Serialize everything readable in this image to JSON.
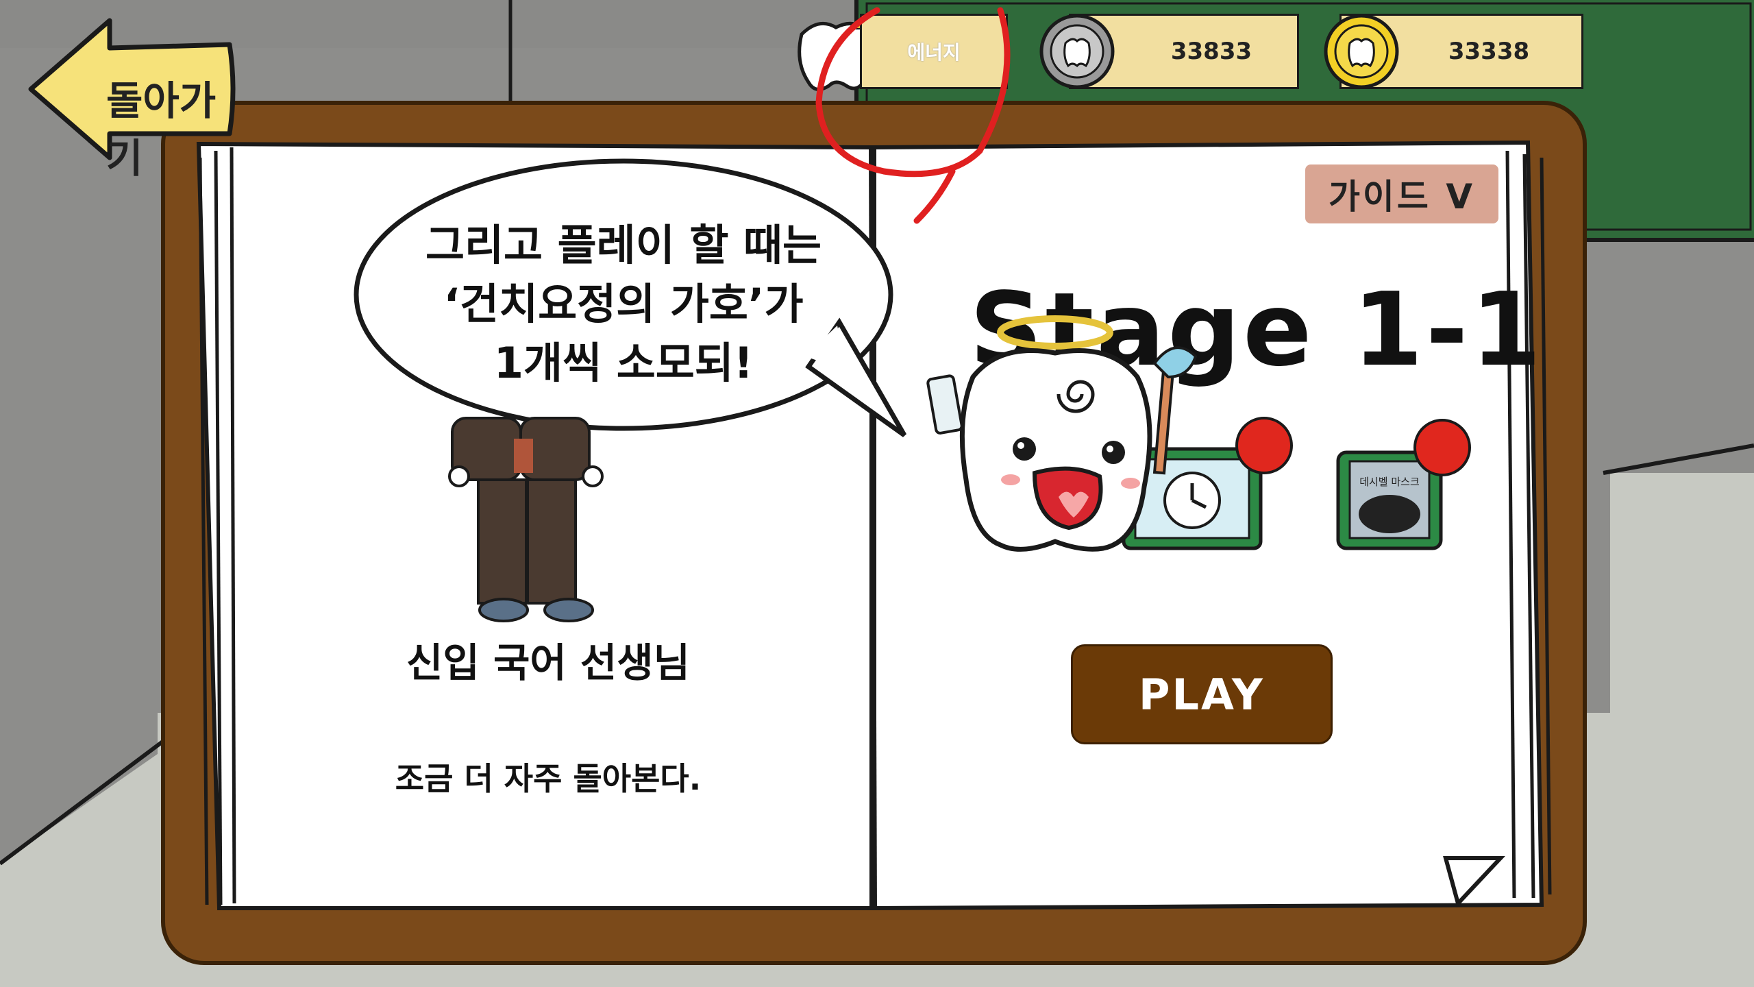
{
  "hud": {
    "energy_label": "에너지",
    "silver_coins": "33833",
    "gold_coins": "33338"
  },
  "back_button": {
    "label": "돌아가기"
  },
  "guide_button": {
    "label": "가이드 V"
  },
  "stage": {
    "title": "Stage 1-1"
  },
  "dialog": {
    "line1": "그리고 플레이 할 때는",
    "line2": "‘건치요정의 가호’가",
    "line3": "1개씩 소모되!"
  },
  "character": {
    "name": "신입 국어 선생님",
    "description": "조금 더 자주 돌아본다."
  },
  "items": [
    {
      "name": "clock-item-icon"
    },
    {
      "name": "mask-item-icon",
      "card_text": "데시벨 마스크"
    }
  ],
  "play_button": {
    "label": "PLAY"
  },
  "colors": {
    "board_frame": "#7b4a1a",
    "chalkboard": "#2f6a3a",
    "hud_pill": "#f2dfa0",
    "guide_button": "#d9a593",
    "play_button": "#6b3a07",
    "back_arrow": "#f6e27a",
    "annotation_red": "#e02020",
    "item_frame": "#2c8a45",
    "item_badge": "#e0271e"
  }
}
